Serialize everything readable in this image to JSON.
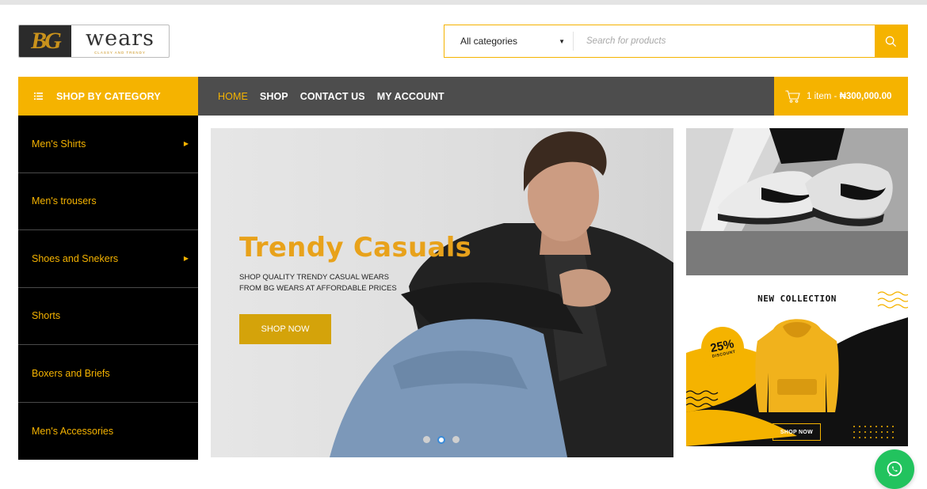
{
  "brand": {
    "mark": "BG",
    "name": "wears",
    "tagline": "CLASSY AND TRENDY"
  },
  "search": {
    "category": "All categories",
    "placeholder": "Search for products",
    "button_icon": "search-icon"
  },
  "nav": {
    "category_label": "SHOP BY CATEGORY",
    "links": [
      "HOME",
      "SHOP",
      "CONTACT US",
      "MY ACCOUNT"
    ],
    "active": "HOME"
  },
  "cart": {
    "count": "1 item",
    "separator": " - ",
    "total": "₦300,000.00",
    "icon": "cart-icon"
  },
  "sidebar": {
    "items": [
      {
        "label": "Men's Shirts",
        "submenu": true
      },
      {
        "label": "Men's trousers",
        "submenu": false
      },
      {
        "label": "Shoes and Snekers",
        "submenu": true
      },
      {
        "label": "Shorts",
        "submenu": false
      },
      {
        "label": "Boxers and Briefs",
        "submenu": false
      },
      {
        "label": "Men's Accessories",
        "submenu": false
      }
    ]
  },
  "hero": {
    "title": "Trendy Casuals",
    "subtitle_line1": "SHOP QUALITY TRENDY CASUAL WEARS",
    "subtitle_line2": "FROM BG WEARS AT AFFORDABLE PRICES",
    "button": "SHOP NOW",
    "slides": 3,
    "active_slide": 2
  },
  "promo": {
    "title": "NEW COLLECTION",
    "discount": "25%",
    "discount_label": "DISCOUNT",
    "button": "SHOP NOW"
  },
  "colors": {
    "accent": "#f5b300",
    "nav_bg": "#4d4d4d",
    "sidebar_bg": "#000000",
    "whatsapp": "#22c35e"
  }
}
